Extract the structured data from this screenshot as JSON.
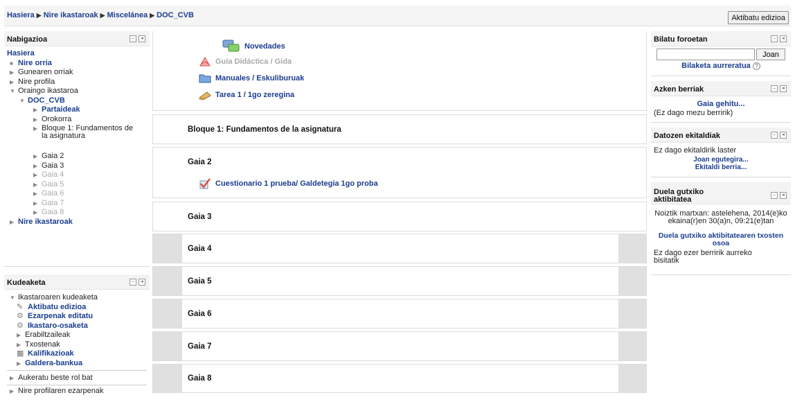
{
  "breadcrumb": [
    "Hasiera",
    "Nire ikastaroak",
    "Miscelánea",
    "DOC_CVB"
  ],
  "edit_button": "Aktibatu edizioa",
  "nav": {
    "title": "Nabigazioa",
    "items": [
      {
        "label": "Hasiera"
      },
      {
        "label": "Nire orria"
      },
      {
        "label": "Gunearen orriak"
      },
      {
        "label": "Nire profila"
      },
      {
        "label": "Oraingo ikastaroa"
      },
      {
        "label": "DOC_CVB"
      },
      {
        "label": "Partaideak"
      },
      {
        "label": "Orokorra"
      },
      {
        "label": "Bloque 1: Fundamentos de la asignatura"
      },
      {
        "label": "Gaia 2"
      },
      {
        "label": "Gaia 3"
      },
      {
        "label": "Gaia 4"
      },
      {
        "label": "Gaia 5"
      },
      {
        "label": "Gaia 6"
      },
      {
        "label": "Gaia 7"
      },
      {
        "label": "Gaia 8"
      },
      {
        "label": "Nire ikastaroak"
      }
    ]
  },
  "admin": {
    "title": "Kudeaketa",
    "items": [
      {
        "label": "Ikastaroaren kudeaketa"
      },
      {
        "label": "Aktibatu edizioa"
      },
      {
        "label": "Ezarpenak editatu"
      },
      {
        "label": "Ikastaro-osaketa"
      },
      {
        "label": "Erabiltzaileak"
      },
      {
        "label": "Txostenak"
      },
      {
        "label": "Kalifikazioak"
      },
      {
        "label": "Galdera-bankua"
      },
      {
        "label": "Aukeratu beste rol bat"
      },
      {
        "label": "Nire profilaren ezarpenak"
      }
    ]
  },
  "main": {
    "general": [
      {
        "label": "Novedades",
        "icon": "forum-icon"
      },
      {
        "label": "Guía Didáctica / Gida",
        "icon": "pdf-icon"
      },
      {
        "label": "Manuales / Eskuliburuak",
        "icon": "folder-icon"
      },
      {
        "label": "Tarea 1 / 1go zeregina",
        "icon": "assignment-icon"
      }
    ],
    "sections": [
      {
        "title": "Bloque 1: Fundamentos de la asignatura"
      },
      {
        "title": "Gaia 2",
        "activity": "Cuestionario 1 prueba/ Galdetegia 1go proba"
      },
      {
        "title": "Gaia 3"
      },
      {
        "title": "Gaia 4"
      },
      {
        "title": "Gaia 5"
      },
      {
        "title": "Gaia 6"
      },
      {
        "title": "Gaia 7"
      },
      {
        "title": "Gaia 8"
      }
    ]
  },
  "search": {
    "title": "Bilatu foroetan",
    "button": "Joan",
    "advanced": "Bilaketa aurreratua"
  },
  "news": {
    "title": "Azken berriak",
    "add": "Gaia gehitu...",
    "empty": "(Ez dago mezu berririk)"
  },
  "events": {
    "title": "Datozen ekitaldiak",
    "empty": "Ez dago ekitaldirik laster",
    "calendar": "Joan egutegira...",
    "new": "Ekitaldi berria..."
  },
  "recent": {
    "title": "Duela gutxiko aktibitatea",
    "since": "Noiztik martxan: astelehena, 2014(e)ko ekaina(r)en 30(a)n, 09:21(e)tan",
    "full": "Duela gutxiko aktibitatearen txosten osoa",
    "empty": "Ez dago ezer berririk aurreko bisitatik"
  },
  "colors": {
    "link": "#1a3d8f",
    "header_bg": "#f3f3f3",
    "gutter": "#e0e0e0"
  }
}
